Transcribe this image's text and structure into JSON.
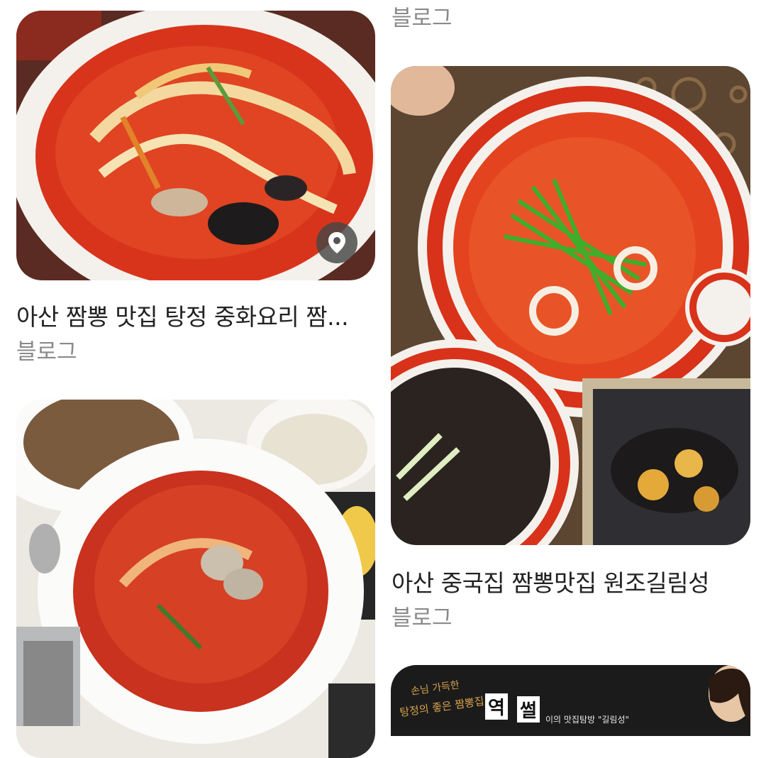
{
  "cards": [
    {
      "title": "아산 짬뽕 맛집 탕정 중화요리 짬...",
      "source": "블로그",
      "has_location_pin": true,
      "pin_icon": "location-pin-icon"
    },
    {
      "title": "",
      "source": "블로그"
    },
    {
      "title": "아산 중국집 짬뽕맛집 원조길림성",
      "source": "블로그"
    },
    {
      "title": "",
      "source": ""
    },
    {
      "title": "",
      "source": "",
      "banner_text": {
        "left_line1": "손님 가득한",
        "left_line2": "탕정의 좋은 짬뽕집",
        "big1": "역",
        "big2": "썰",
        "right": "이의 맛집탐방 \"길림성\""
      }
    }
  ]
}
